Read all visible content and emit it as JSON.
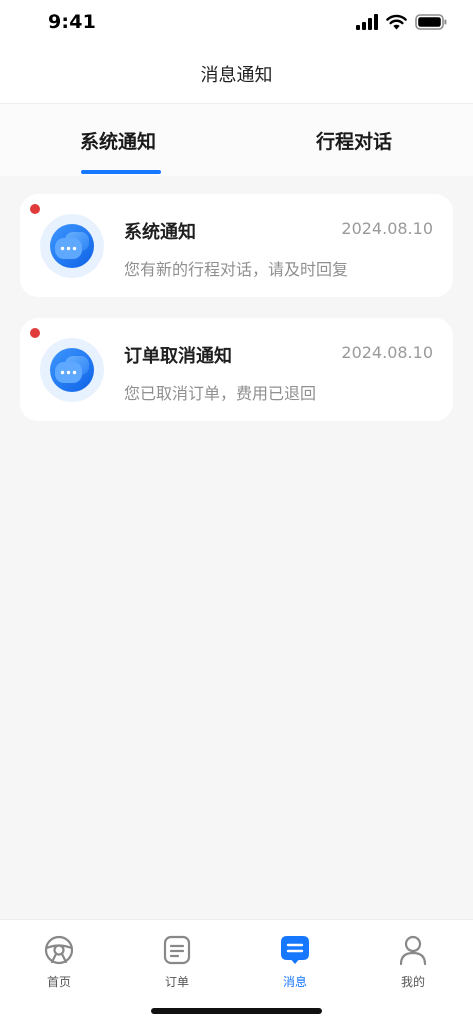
{
  "status_bar": {
    "time": "9:41",
    "icons": [
      "signal-icon",
      "wifi-icon",
      "battery-icon"
    ]
  },
  "nav": {
    "title": "消息通知"
  },
  "tabs": [
    {
      "label": "系统通知",
      "active": true
    },
    {
      "label": "行程对话",
      "active": false
    }
  ],
  "messages": [
    {
      "title": "系统通知",
      "date": "2024.08.10",
      "body": "您有新的行程对话，请及时回复",
      "unread": true,
      "icon": "chat-bubbles-icon"
    },
    {
      "title": "订单取消通知",
      "date": "2024.08.10",
      "body": "您已取消订单，费用已退回",
      "unread": true,
      "icon": "chat-bubbles-icon"
    }
  ],
  "tabbar": [
    {
      "label": "首页",
      "icon": "steering-wheel-icon",
      "active": false
    },
    {
      "label": "订单",
      "icon": "order-list-icon",
      "active": false
    },
    {
      "label": "消息",
      "icon": "message-icon",
      "active": true
    },
    {
      "label": "我的",
      "icon": "user-icon",
      "active": false
    }
  ],
  "colors": {
    "accent": "#1677ff",
    "unread_dot": "#e03a3a",
    "background": "#f6f6f6"
  }
}
